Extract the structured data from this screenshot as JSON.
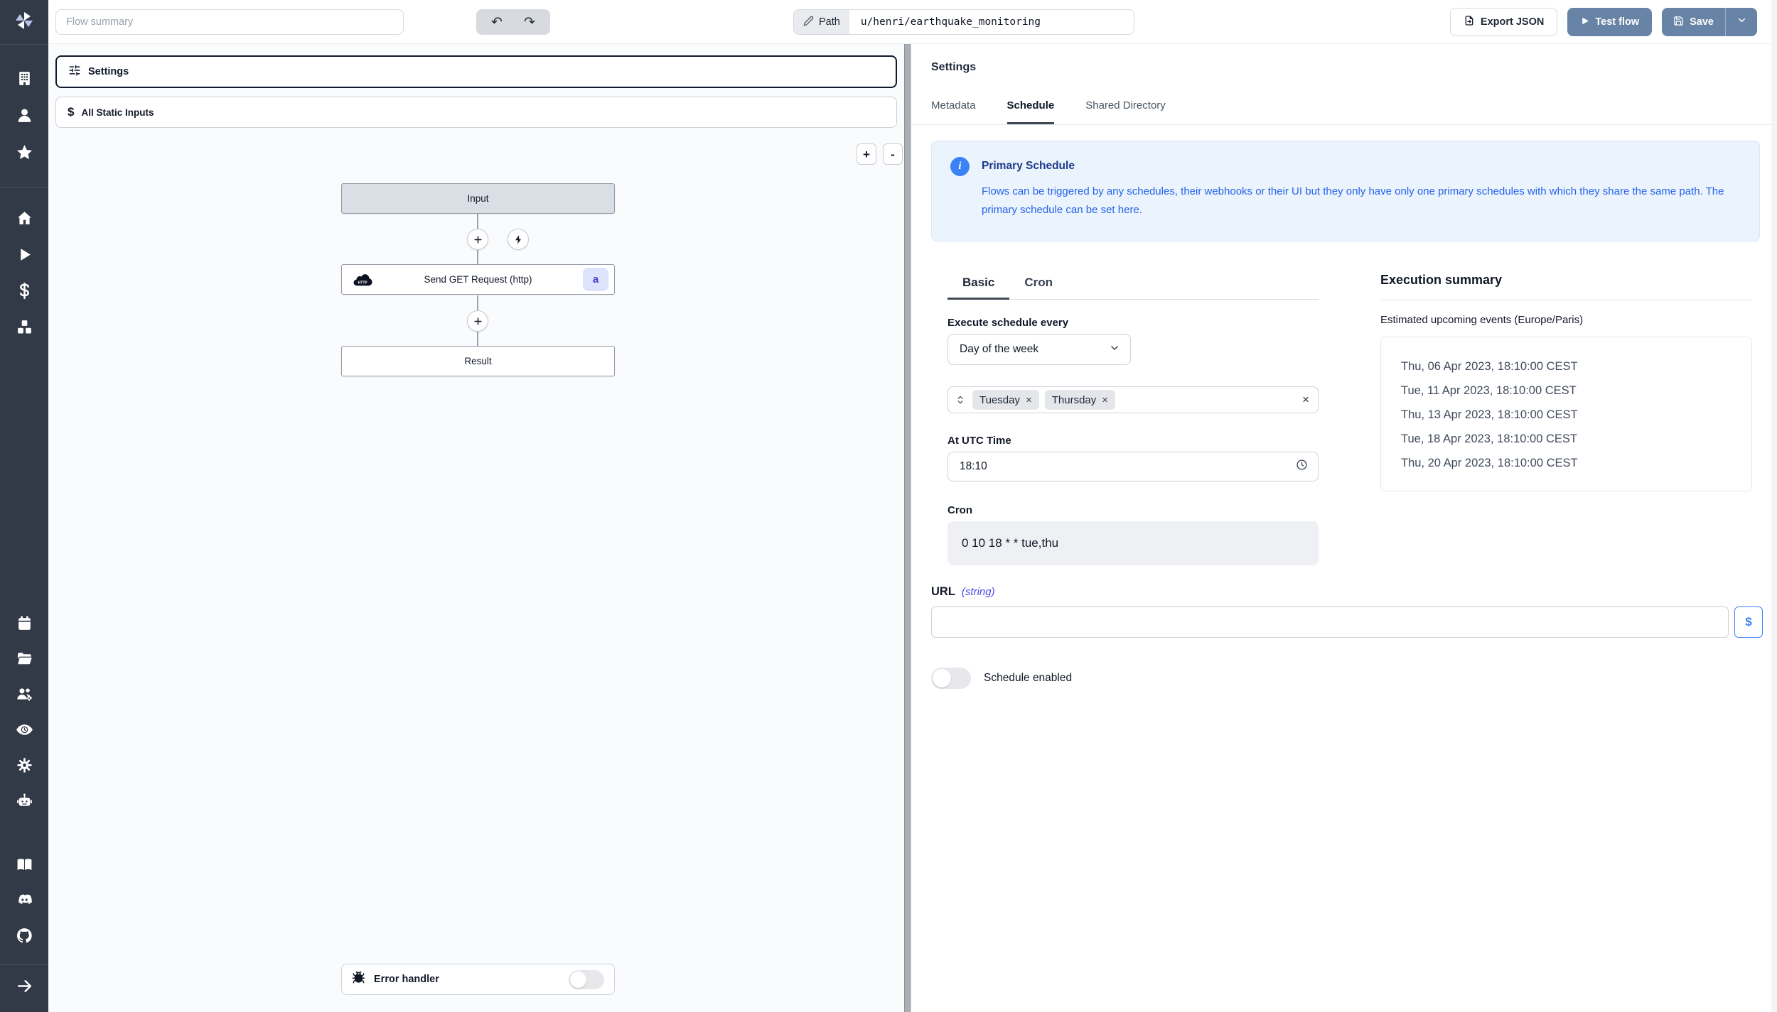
{
  "colors": {
    "sidebar_bg": "#323947",
    "primary_button": "#6784a6",
    "accent_blue": "#3b82f6",
    "info_bg": "#ebf3fd",
    "info_text": "#2563eb",
    "badge_indigo_bg": "#dde3fc",
    "badge_indigo_text": "#4438ca"
  },
  "icons": {
    "undo": "↶",
    "redo": "↷",
    "zoom_in": "+",
    "zoom_out": "-",
    "dollar": "$",
    "close": "×",
    "info": "i",
    "badge_a": "a"
  },
  "sidebar": {
    "icon_names": [
      "windmill-logo",
      "building",
      "user",
      "star",
      "home",
      "play-runs",
      "dollar-variables",
      "boxes-resources",
      "calendar-schedules",
      "folder-open",
      "users-settings",
      "audit-eye",
      "gear-settings",
      "bot",
      "book-docs",
      "discord",
      "github",
      "arrow-right-expand"
    ]
  },
  "topbar": {
    "flow_summary_placeholder": "Flow summary",
    "path_label": "Path",
    "path_value": "u/henri/earthquake_monitoring",
    "export_json_label": "Export JSON",
    "test_flow_label": "Test flow",
    "save_label": "Save"
  },
  "flow": {
    "settings_label": "Settings",
    "all_static_inputs_label": "All Static Inputs",
    "input_node_label": "Input",
    "http_node_label": "Send GET Request (http)",
    "http_node_badge": "a",
    "result_node_label": "Result",
    "error_handler_label": "Error handler"
  },
  "schedule": {
    "panel_title": "Settings",
    "tabs": [
      "Metadata",
      "Schedule",
      "Shared Directory"
    ],
    "active_tab": "Schedule",
    "info_title": "Primary Schedule",
    "info_body": "Flows can be triggered by any schedules, their webhooks or their UI but they only have only one primary schedules with which they share the same path. The primary schedule can be set here.",
    "mode_tabs": [
      "Basic",
      "Cron"
    ],
    "active_mode_tab": "Basic",
    "execute_label": "Execute schedule every",
    "frequency_value": "Day of the week",
    "selected_days": [
      "Tuesday",
      "Thursday"
    ],
    "utc_label": "At UTC Time",
    "utc_value": "18:10",
    "cron_label": "Cron",
    "cron_value": "0 10 18 * * tue,thu",
    "summary_title": "Execution summary",
    "summary_subtitle": "Estimated upcoming events (Europe/Paris)",
    "events": [
      "Thu, 06 Apr 2023, 18:10:00 CEST",
      "Tue, 11 Apr 2023, 18:10:00 CEST",
      "Thu, 13 Apr 2023, 18:10:00 CEST",
      "Tue, 18 Apr 2023, 18:10:00 CEST",
      "Thu, 20 Apr 2023, 18:10:00 CEST"
    ],
    "url_label": "URL",
    "url_type": "(string)",
    "schedule_enabled_label": "Schedule enabled"
  }
}
